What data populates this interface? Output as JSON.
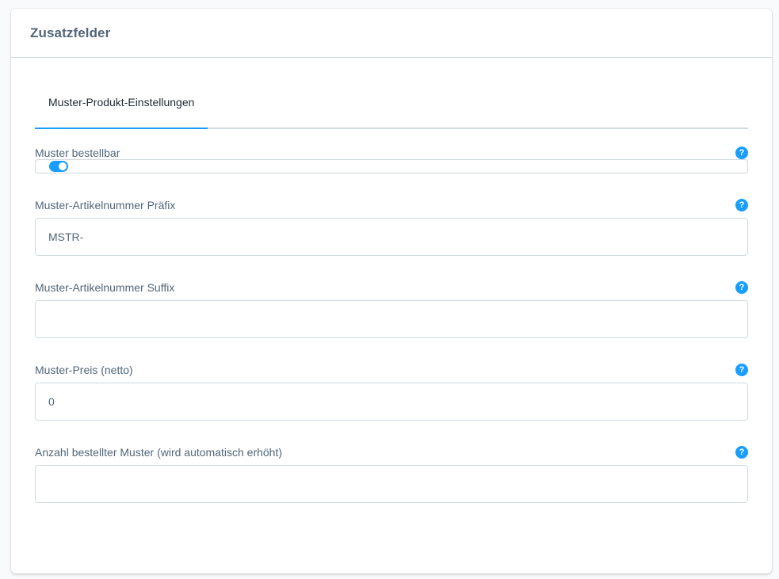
{
  "card": {
    "title": "Zusatzfelder"
  },
  "tabs": [
    {
      "label": "Muster-Produkt-Einstellungen",
      "active": true
    }
  ],
  "fields": {
    "orderable": {
      "label": "Muster bestellbar",
      "type": "toggle",
      "checked": true
    },
    "prefix": {
      "label": "Muster-Artikelnummer Präfix",
      "value": "MSTR-",
      "placeholder": ""
    },
    "suffix": {
      "label": "Muster-Artikelnummer Suffix",
      "value": "",
      "placeholder": ""
    },
    "price": {
      "label": "Muster-Preis (netto)",
      "value": "0",
      "placeholder": ""
    },
    "count": {
      "label": "Anzahl bestellter Muster (wird automatisch erhöht)",
      "value": "",
      "placeholder": ""
    }
  },
  "help_icon": {
    "glyph": "?",
    "icon": "help-icon"
  },
  "colors": {
    "accent": "#189eff",
    "label": "#52667a",
    "border": "#d1d9e0"
  }
}
